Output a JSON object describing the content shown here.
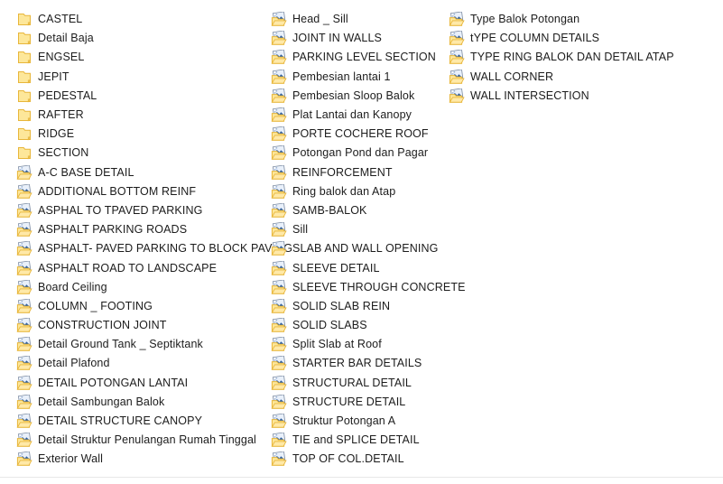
{
  "window": {
    "view": "large-icons-list",
    "background_color": "#ffffff",
    "text_color": "#1c1c1c"
  },
  "icons": {
    "plain_folder": "folder-icon",
    "folder_with_preview": "folder-with-thumbnail-icon",
    "folder_fill": "#fde79a",
    "folder_edge": "#e8b63a",
    "thumbnail_blue": "#2f5f9e",
    "thumbnail_light": "#e9f0fa"
  },
  "columns": [
    {
      "name": "column-1",
      "items": [
        {
          "label": "CASTEL",
          "icon": "folder-icon"
        },
        {
          "label": "Detail Baja",
          "icon": "folder-icon"
        },
        {
          "label": "ENGSEL",
          "icon": "folder-icon"
        },
        {
          "label": "JEPIT",
          "icon": "folder-icon"
        },
        {
          "label": "PEDESTAL",
          "icon": "folder-icon"
        },
        {
          "label": "RAFTER",
          "icon": "folder-icon"
        },
        {
          "label": "RIDGE",
          "icon": "folder-icon"
        },
        {
          "label": "SECTION",
          "icon": "folder-icon"
        },
        {
          "label": "A-C BASE DETAIL",
          "icon": "folder-with-thumbnail-icon"
        },
        {
          "label": "ADDITIONAL BOTTOM REINF",
          "icon": "folder-with-thumbnail-icon"
        },
        {
          "label": "ASPHAL TO TPAVED PARKING",
          "icon": "folder-with-thumbnail-icon"
        },
        {
          "label": "ASPHALT PARKING ROADS",
          "icon": "folder-with-thumbnail-icon"
        },
        {
          "label": "ASPHALT- PAVED PARKING TO BLOCK PAVING",
          "icon": "folder-with-thumbnail-icon"
        },
        {
          "label": "ASPHALT ROAD TO LANDSCAPE",
          "icon": "folder-with-thumbnail-icon"
        },
        {
          "label": "Board Ceiling",
          "icon": "folder-with-thumbnail-icon"
        },
        {
          "label": "COLUMN _ FOOTING",
          "icon": "folder-with-thumbnail-icon"
        },
        {
          "label": "CONSTRUCTION JOINT",
          "icon": "folder-with-thumbnail-icon"
        },
        {
          "label": "Detail Ground Tank _ Septiktank",
          "icon": "folder-with-thumbnail-icon"
        },
        {
          "label": "Detail Plafond",
          "icon": "folder-with-thumbnail-icon"
        },
        {
          "label": "DETAIL POTONGAN LANTAI",
          "icon": "folder-with-thumbnail-icon"
        },
        {
          "label": "Detail Sambungan Balok",
          "icon": "folder-with-thumbnail-icon"
        },
        {
          "label": "DETAIL STRUCTURE CANOPY",
          "icon": "folder-with-thumbnail-icon"
        },
        {
          "label": "Detail Struktur Penulangan Rumah Tinggal",
          "icon": "folder-with-thumbnail-icon"
        },
        {
          "label": "Exterior Wall",
          "icon": "folder-with-thumbnail-icon"
        }
      ]
    },
    {
      "name": "column-2",
      "items": [
        {
          "label": "Head _ Sill",
          "icon": "folder-with-thumbnail-icon"
        },
        {
          "label": "JOINT IN WALLS",
          "icon": "folder-with-thumbnail-icon"
        },
        {
          "label": "PARKING LEVEL SECTION",
          "icon": "folder-with-thumbnail-icon"
        },
        {
          "label": "Pembesian lantai 1",
          "icon": "folder-with-thumbnail-icon"
        },
        {
          "label": "Pembesian Sloop Balok",
          "icon": "folder-with-thumbnail-icon"
        },
        {
          "label": "Plat Lantai dan Kanopy",
          "icon": "folder-with-thumbnail-icon"
        },
        {
          "label": "PORTE COCHERE ROOF",
          "icon": "folder-with-thumbnail-icon"
        },
        {
          "label": "Potongan Pond dan Pagar",
          "icon": "folder-with-thumbnail-icon"
        },
        {
          "label": "REINFORCEMENT",
          "icon": "folder-with-thumbnail-icon"
        },
        {
          "label": "Ring balok dan Atap",
          "icon": "folder-with-thumbnail-icon"
        },
        {
          "label": "SAMB-BALOK",
          "icon": "folder-with-thumbnail-icon"
        },
        {
          "label": "Sill",
          "icon": "folder-with-thumbnail-icon"
        },
        {
          "label": "SLAB AND WALL OPENING",
          "icon": "folder-with-thumbnail-icon"
        },
        {
          "label": "SLEEVE DETAIL",
          "icon": "folder-with-thumbnail-icon"
        },
        {
          "label": "SLEEVE THROUGH CONCRETE",
          "icon": "folder-with-thumbnail-icon"
        },
        {
          "label": "SOLID SLAB REIN",
          "icon": "folder-with-thumbnail-icon"
        },
        {
          "label": "SOLID SLABS",
          "icon": "folder-with-thumbnail-icon"
        },
        {
          "label": "Split Slab at Roof",
          "icon": "folder-with-thumbnail-icon"
        },
        {
          "label": "STARTER BAR DETAILS",
          "icon": "folder-with-thumbnail-icon"
        },
        {
          "label": "STRUCTURAL DETAIL",
          "icon": "folder-with-thumbnail-icon"
        },
        {
          "label": "STRUCTURE DETAIL",
          "icon": "folder-with-thumbnail-icon"
        },
        {
          "label": "Struktur Potongan A",
          "icon": "folder-with-thumbnail-icon"
        },
        {
          "label": "TIE and SPLICE DETAIL",
          "icon": "folder-with-thumbnail-icon"
        },
        {
          "label": "TOP OF COL.DETAIL",
          "icon": "folder-with-thumbnail-icon"
        }
      ]
    },
    {
      "name": "column-3",
      "items": [
        {
          "label": "Type Balok Potongan",
          "icon": "folder-with-thumbnail-icon"
        },
        {
          "label": "tYPE COLUMN DETAILS",
          "icon": "folder-with-thumbnail-icon"
        },
        {
          "label": "TYPE RING BALOK DAN DETAIL ATAP",
          "icon": "folder-with-thumbnail-icon"
        },
        {
          "label": "WALL CORNER",
          "icon": "folder-with-thumbnail-icon"
        },
        {
          "label": "WALL INTERSECTION",
          "icon": "folder-with-thumbnail-icon"
        }
      ]
    }
  ]
}
